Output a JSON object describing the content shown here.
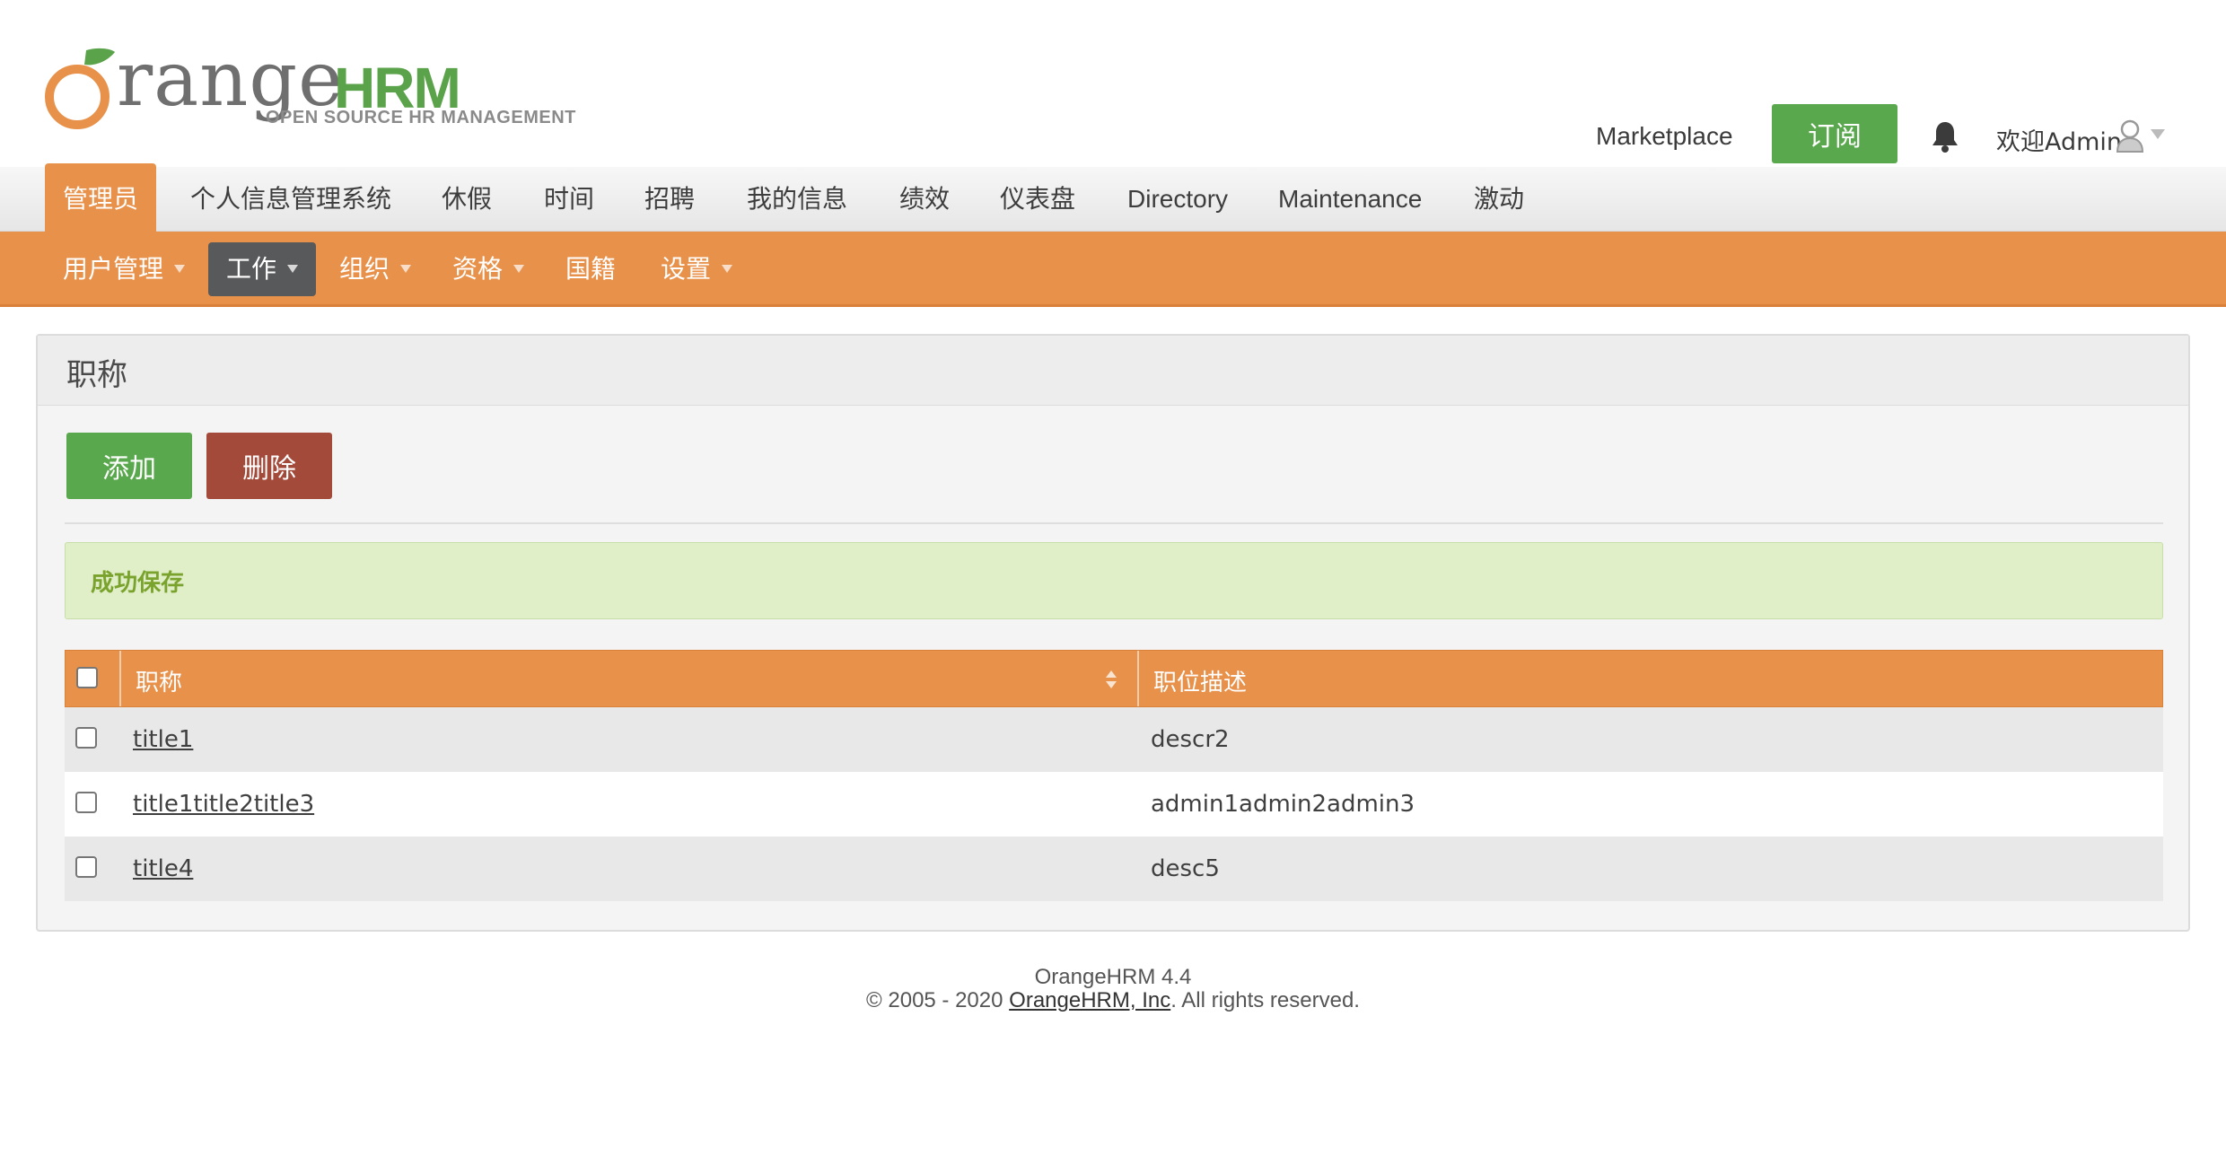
{
  "header": {
    "logo_word": "range",
    "logo_hrm": "HRM",
    "logo_tagline": "OPEN SOURCE HR MANAGEMENT",
    "marketplace": "Marketplace",
    "subscribe": "订阅",
    "welcome": "欢迎Admin",
    "icons": [
      "orange-logo-icon",
      "bell-icon",
      "user-avatar-icon",
      "chevron-down-icon"
    ]
  },
  "main_nav": [
    {
      "label": "管理员",
      "active": true
    },
    {
      "label": "个人信息管理系统"
    },
    {
      "label": "休假"
    },
    {
      "label": "时间"
    },
    {
      "label": "招聘"
    },
    {
      "label": "我的信息"
    },
    {
      "label": "绩效"
    },
    {
      "label": "仪表盘"
    },
    {
      "label": "Directory"
    },
    {
      "label": "Maintenance"
    },
    {
      "label": "激动"
    }
  ],
  "sub_nav": [
    {
      "label": "用户管理",
      "has_dropdown": true
    },
    {
      "label": "工作",
      "has_dropdown": true,
      "active": true
    },
    {
      "label": "组织",
      "has_dropdown": true
    },
    {
      "label": "资格",
      "has_dropdown": true
    },
    {
      "label": "国籍",
      "has_dropdown": false
    },
    {
      "label": "设置",
      "has_dropdown": true
    }
  ],
  "panel": {
    "title": "职称",
    "add_label": "添加",
    "delete_label": "删除",
    "success_message": "成功保存"
  },
  "table": {
    "columns": [
      "职称",
      "职位描述"
    ],
    "rows": [
      {
        "title": "title1",
        "description": "descr2"
      },
      {
        "title": "title1title2title3",
        "description": "admin1admin2admin3"
      },
      {
        "title": "title4",
        "description": "desc5"
      }
    ]
  },
  "footer": {
    "version": "OrangeHRM 4.4",
    "copyright_prefix": "© 2005 - 2020 ",
    "company_link": "OrangeHRM, Inc",
    "copyright_suffix": ". All rights reserved."
  },
  "colors": {
    "brand_orange": "#e8914a",
    "brand_green": "#5aa84d",
    "danger": "#a34a3a",
    "active_subnav": "#58595b",
    "success_bg": "#e1efc8",
    "success_text": "#7aa32e"
  }
}
